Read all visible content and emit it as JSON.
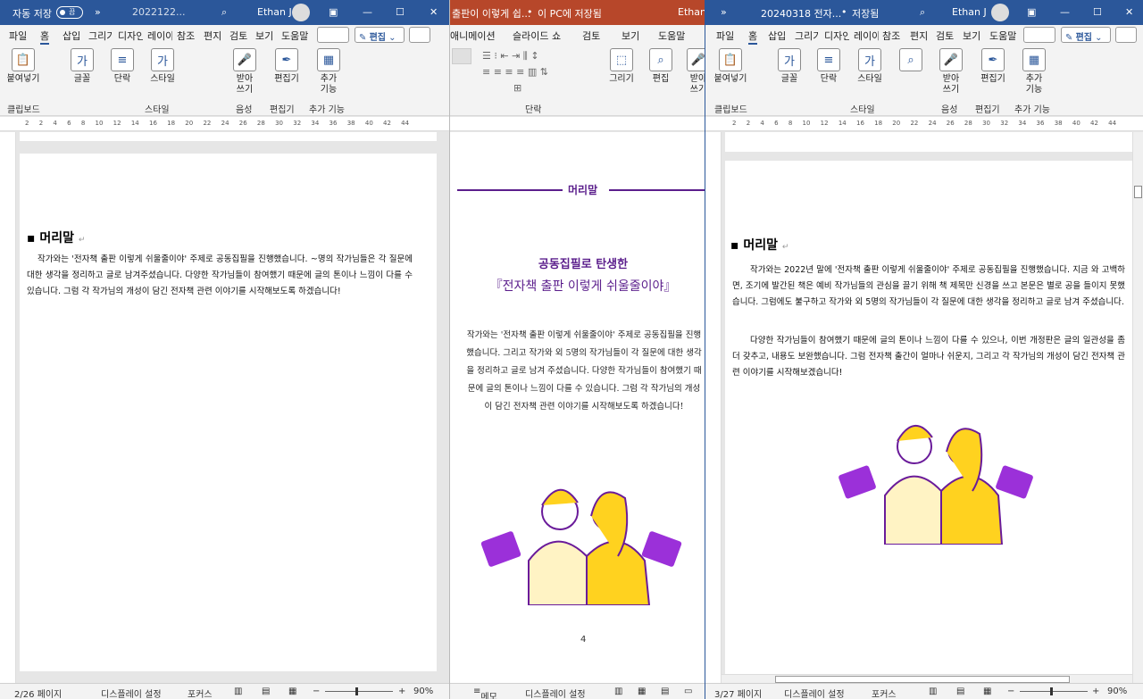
{
  "windows": [
    {
      "autosave": "자동 저장",
      "toggle": "끔",
      "title": "2022122...",
      "user": "Ethan J",
      "tabs": [
        "파일",
        "홈",
        "삽입",
        "그리기",
        "디자인",
        "레이아웃",
        "참조",
        "편지",
        "검토",
        "보기",
        "도움말"
      ],
      "edit_btn": "편집",
      "ribbon": [
        {
          "label": "붙여넣기"
        },
        {
          "label": "글꼴"
        },
        {
          "label": "단락"
        },
        {
          "label": "스타일"
        },
        {
          "label": "받아\n쓰기"
        },
        {
          "label": "편집기"
        },
        {
          "label": "추가\n기능"
        }
      ],
      "groups": [
        "클립보드",
        "스타일",
        "음성",
        "편집기",
        "추가 기능"
      ],
      "ruler": [
        "2",
        "2",
        "4",
        "6",
        "8",
        "10",
        "12",
        "14",
        "16",
        "18",
        "20",
        "22",
        "24",
        "26",
        "28",
        "30",
        "32",
        "34",
        "36",
        "38",
        "40",
        "42",
        "44",
        "46",
        "48"
      ],
      "doc_heading": "머리말",
      "doc_body": "작가와는 '전자책 출판 이렇게 쉬울줄이야' 주제로 공동집필을 진행했습니다. ~명의 작가님들은 각 질문에 대한 생각을 정리하고 글로 남겨주셨습니다. 다양한 작가님들이 참여했기 때문에 글의 톤이나 느낌이 다를 수 있습니다. 그럼 각 작가님의 개성이 담긴 전자책 관련 이야기를 시작해보도록 하겠습니다!",
      "status_page": "2/26 페이지",
      "status_display": "디스플레이 설정",
      "status_focus": "포커스",
      "zoom": "90%"
    },
    {
      "title": "출판이 이렇게 쉽...",
      "saved": "이 PC에 저장됨",
      "user": "Ethan",
      "tabs": [
        "애니메이션",
        "슬라이드 쇼",
        "검토",
        "보기",
        "도움말"
      ],
      "ribbon": [
        {
          "label": "그리기"
        },
        {
          "label": "편집"
        },
        {
          "label": "받아\n쓰기"
        }
      ],
      "groups": [
        "단락"
      ],
      "slide_header": "머리말",
      "slide_title1": "공동집필로 탄생한",
      "slide_title2": "『전자책 출판 이렇게 쉬울줄이야』",
      "slide_body": "작가와는 '전자책 출판 이렇게 쉬울줄이야' 주제로 공동집필을 진행했습니다. 그리고 작가와 외 5명의 작가님들이 각 질문에 대한 생각을 정리하고 글로 남겨 주셨습니다. 다양한 작가님들이 참여했기 때문에 글의 톤이나 느낌이 다를 수 있습니다. 그럼 각 작가님의 개성이 담긴 전자책 관련 이야기를 시작해보도록 하겠습니다!",
      "page_num": "4",
      "status_memo": "메모",
      "status_display": "디스플레이 설정"
    },
    {
      "title": "20240318 전자...",
      "saved": "저장됨",
      "user": "Ethan J",
      "tabs": [
        "파일",
        "홈",
        "삽입",
        "그리기",
        "디자인",
        "레이아웃",
        "참조",
        "편지",
        "검토",
        "보기",
        "도움말"
      ],
      "edit_btn": "편집",
      "ribbon": [
        {
          "label": "붙여넣기"
        },
        {
          "label": "글꼴"
        },
        {
          "label": "단락"
        },
        {
          "label": "스타일"
        },
        {
          "label": "받아\n쓰기"
        },
        {
          "label": "편집기"
        },
        {
          "label": "추가\n기능"
        }
      ],
      "groups": [
        "클립보드",
        "스타일",
        "음성",
        "편집기",
        "추가 기능"
      ],
      "ruler": [
        "2",
        "2",
        "4",
        "6",
        "8",
        "10",
        "12",
        "14",
        "16",
        "18",
        "20",
        "22",
        "24",
        "26",
        "28",
        "30",
        "32",
        "34",
        "36",
        "38",
        "40",
        "42",
        "44",
        "46",
        "48"
      ],
      "doc_heading": "머리말",
      "doc_body1": "작가와는 2022년 말에 '전자책 출판 이렇게 쉬울줄이야' 주제로 공동집필을 진행했습니다. 지금 와 고백하면, 조기에 발간된 책은 예비 작가님들의 관심을 끌기 위해 책 제목만 신경을 쓰고 본문은 별로 공을 들이지 못했습니다. 그럼에도 불구하고 작가와 외 5명의 작가님들이 각 질문에 대한 생각을 정리하고 글로 남겨 주셨습니다.",
      "doc_body2": "다양한 작가님들이 참여했기 때문에 글의 톤이나 느낌이 다를 수 있으나, 이번 개정판은 글의 일관성을 좀 더 갖추고, 내용도 보완했습니다. 그럼 전자책 출간이 얼마나 쉬운지, 그리고 각 작가님의 개성이 담긴 전자책 관련 이야기를 시작해보겠습니다!",
      "status_page": "3/27 페이지",
      "status_display": "디스플레이 설정",
      "status_focus": "포커스",
      "zoom": "90%"
    }
  ],
  "colors": {
    "word_blue": "#2b579a",
    "ppt_red": "#b7472a",
    "purple": "#6a1b9a",
    "yellow": "#ffd21f"
  }
}
